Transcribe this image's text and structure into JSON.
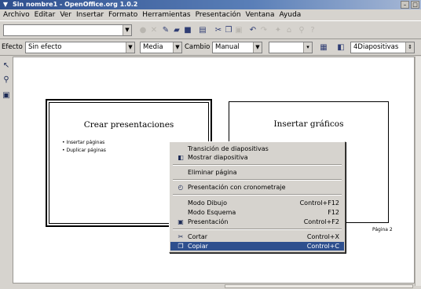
{
  "window": {
    "title": "Sin nombre1 - OpenOffice.org 1.0.2",
    "sys_menu": "▼",
    "minimize": "–",
    "maximize": "□"
  },
  "menubar": [
    "Archivo",
    "Editar",
    "Ver",
    "Insertar",
    "Formato",
    "Herramientas",
    "Presentación",
    "Ventana",
    "Ayuda"
  ],
  "toolbar1": {
    "url_combo_value": "",
    "icons": [
      "go-icon",
      "stop-icon",
      "edit-file-icon",
      "open-icon",
      "save-icon",
      "print-icon",
      "cut-icon",
      "copy-icon",
      "paste-icon",
      "undo-icon",
      "redo-icon",
      "navigator-icon",
      "gallery-icon",
      "zoom-icon",
      "help-icon"
    ]
  },
  "toolbar2": {
    "efecto_label": "Efecto",
    "efecto_value": "Sin efecto",
    "speed_value": "Media",
    "cambio_label": "Cambio",
    "cambio_value": "Manual",
    "time_value": "",
    "slides_value": "4Diapositivas"
  },
  "slides": [
    {
      "title": "Crear presentaciones",
      "bullets": [
        "Insertar páginas",
        "Duplicar páginas"
      ],
      "page_label": ""
    },
    {
      "title": "Insertar gráficos",
      "bullets": [],
      "page_label": "Página 2"
    }
  ],
  "context_menu": {
    "items": [
      {
        "label": "Transición de diapositivas",
        "shortcut": "",
        "icon": ""
      },
      {
        "label": "Mostrar diapositiva",
        "shortcut": "",
        "icon": "show-slide-icon"
      },
      {
        "label": "Eliminar página",
        "shortcut": "",
        "icon": ""
      },
      {
        "label": "Presentación con cronometraje",
        "shortcut": "",
        "icon": "rehearse-timing-icon"
      },
      {
        "label": "Modo Dibujo",
        "shortcut": "Control+F12",
        "icon": ""
      },
      {
        "label": "Modo Esquema",
        "shortcut": "F12",
        "icon": ""
      },
      {
        "label": "Presentación",
        "shortcut": "Control+F2",
        "icon": "presentation-icon"
      },
      {
        "label": "Cortar",
        "shortcut": "Control+X",
        "icon": "cut-icon"
      },
      {
        "label": "Copiar",
        "shortcut": "Control+C",
        "icon": "copy-icon"
      }
    ],
    "selected_index": 8
  },
  "colors": {
    "titlebar": "#2e4f8e",
    "selection": "#2e4f8e",
    "chrome": "#d6d3ce"
  }
}
